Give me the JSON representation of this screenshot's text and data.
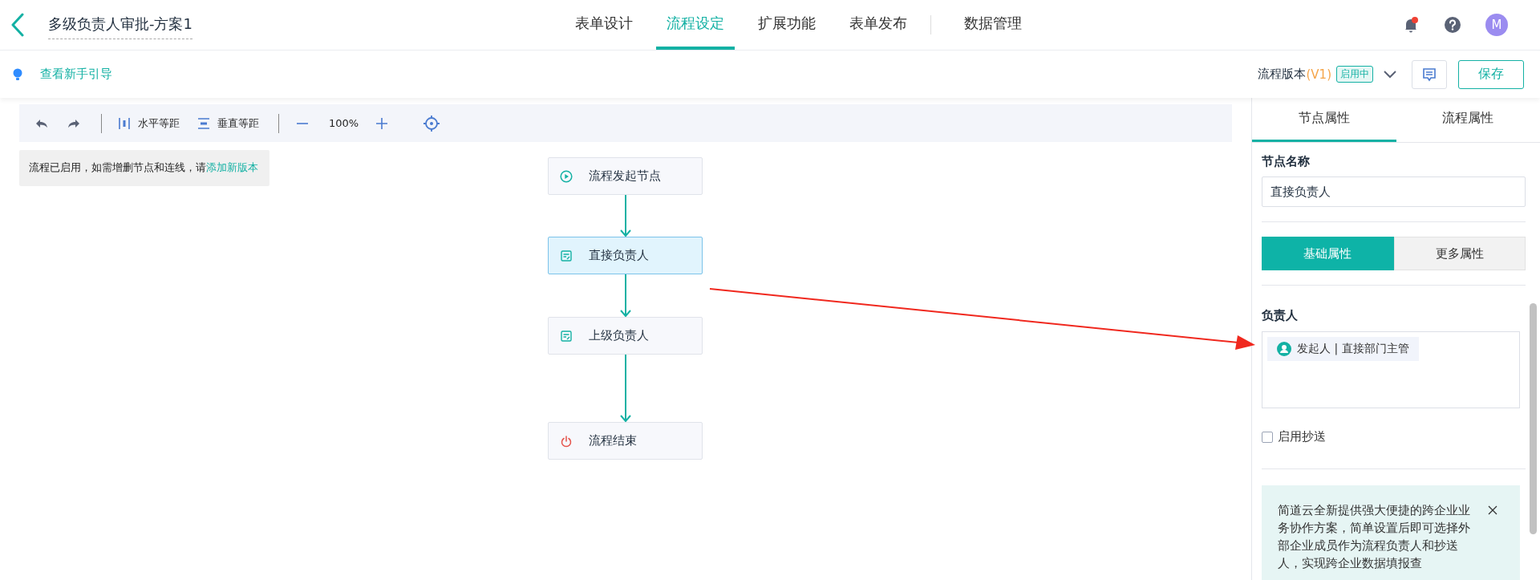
{
  "header": {
    "title": "多级负责人审批-方案1",
    "nav": [
      {
        "label": "表单设计",
        "selected": false
      },
      {
        "label": "流程设定",
        "selected": true
      },
      {
        "label": "扩展功能",
        "selected": false
      },
      {
        "label": "表单发布",
        "selected": false
      },
      {
        "label": "数据管理",
        "selected": false
      }
    ],
    "notification_dot": true,
    "avatar": "M"
  },
  "subbar": {
    "guide_link": "查看新手引导",
    "version_label": "流程版本",
    "version": "(V1)",
    "version_status": "启用中",
    "save": "保存"
  },
  "toolbar": {
    "horizontal": "水平等距",
    "vertical": "垂直等距",
    "zoom": "100%"
  },
  "notice": {
    "text": "流程已启用，如需增删节点和连线，请",
    "link": "添加新版本"
  },
  "nodes": [
    {
      "kind": "start",
      "label": "流程发起节点",
      "selected": false
    },
    {
      "kind": "approve",
      "label": "直接负责人",
      "selected": true
    },
    {
      "kind": "approve",
      "label": "上级负责人",
      "selected": false
    },
    {
      "kind": "end",
      "label": "流程结束",
      "selected": false
    }
  ],
  "panel": {
    "tabs": [
      {
        "label": "节点属性",
        "selected": true
      },
      {
        "label": "流程属性",
        "selected": false
      }
    ],
    "name_label": "节点名称",
    "name_value": "直接负责人",
    "segments": [
      {
        "label": "基础属性",
        "selected": true
      },
      {
        "label": "更多属性",
        "selected": false
      }
    ],
    "owner_label": "负责人",
    "owners": [
      "发起人 | 直接部门主管"
    ],
    "cc": {
      "label": "启用抄送",
      "checked": false
    },
    "tip": "简道云全新提供强大便捷的跨企业业务协作方案，简单设置后即可选择外部企业成员作为流程负责人和抄送人，实现跨企业数据填报查"
  }
}
